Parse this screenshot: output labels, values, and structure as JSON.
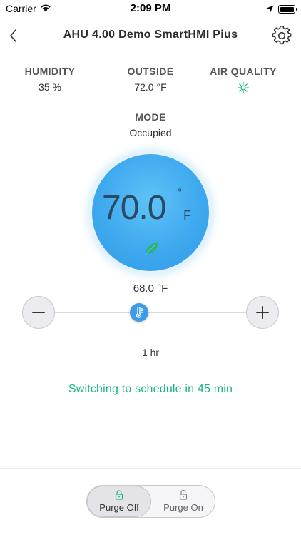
{
  "status_bar": {
    "carrier": "Carrier",
    "time": "2:09 PM",
    "icons": [
      "wifi-icon",
      "location-arrow-icon",
      "battery-icon"
    ]
  },
  "nav": {
    "title": "AHU 4.00 Demo SmartHMI Pius",
    "back_icon": "chevron-left-icon",
    "settings_icon": "gear-icon"
  },
  "stats": {
    "humidity": {
      "label": "HUMIDITY",
      "value": "35 %"
    },
    "outside": {
      "label": "OUTSIDE",
      "value": "72.0 °F"
    },
    "air_quality": {
      "label": "AIR QUALITY",
      "icon": "air-quality-sun-icon",
      "color": "#19b58a"
    }
  },
  "mode": {
    "label": "MODE",
    "value": "Occupied"
  },
  "dial": {
    "temperature": "70.0",
    "degree": "°",
    "unit": "F",
    "leaf_icon": "leaf-icon",
    "leaf_color": "#2fb36f",
    "color": "#3fa9ef"
  },
  "setpoint": {
    "value": "68.0 °F"
  },
  "slider": {
    "minus_icon": "minus-icon",
    "plus_icon": "plus-icon",
    "thumb_icon": "thermometer-icon",
    "level": 0.5
  },
  "duration": "1 hr",
  "schedule_message": "Switching to schedule in 45 min",
  "purge": {
    "options": [
      {
        "label": "Purge Off",
        "icon": "lock-closed-icon",
        "icon_color": "#19b58a",
        "selected": true
      },
      {
        "label": "Purge On",
        "icon": "lock-open-icon",
        "icon_color": "#888888",
        "selected": false
      }
    ]
  },
  "colors": {
    "accent_green": "#19b58a",
    "dial_blue": "#3fa9ef"
  }
}
